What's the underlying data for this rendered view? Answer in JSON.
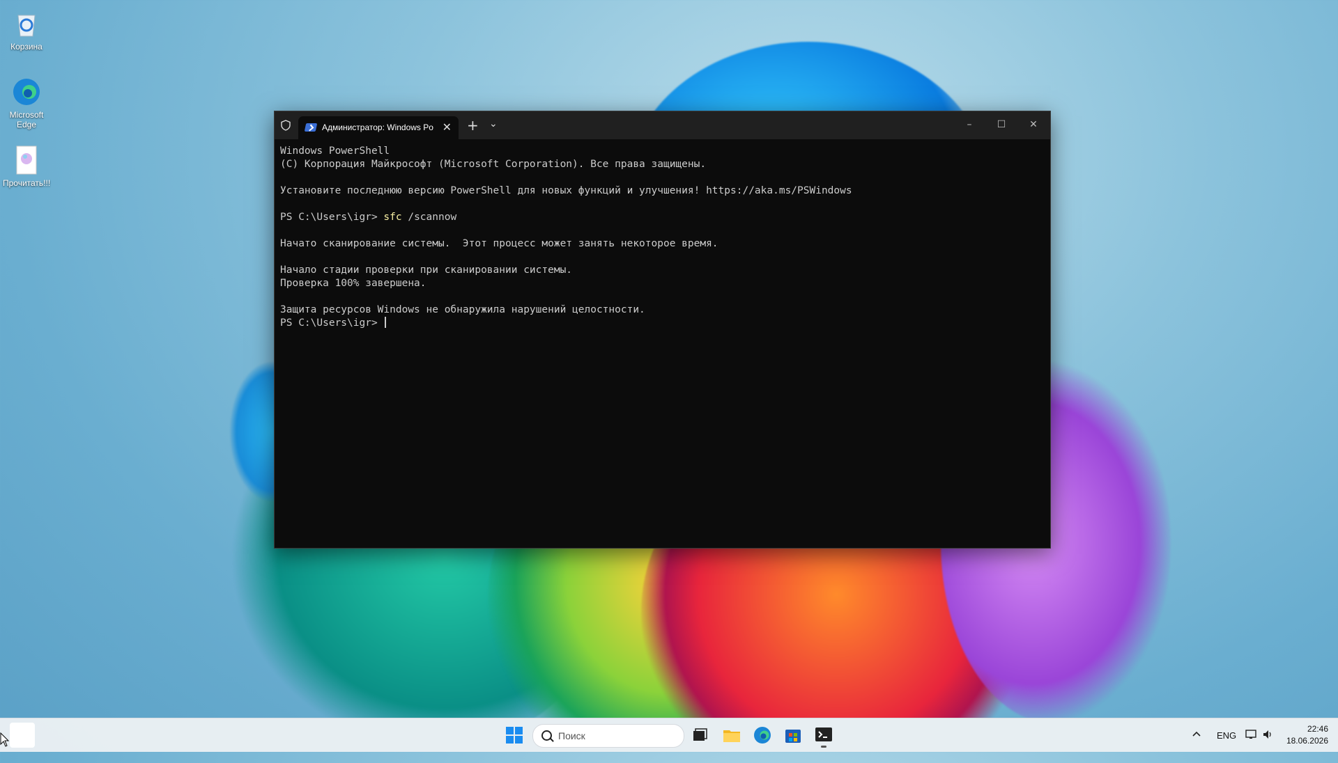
{
  "desktop": {
    "icons": [
      {
        "label": "Корзина",
        "icon": "recycle-bin-icon"
      },
      {
        "label": "Microsoft Edge",
        "icon": "edge-icon"
      },
      {
        "label": "Прочитать!!!",
        "icon": "document-icon"
      }
    ]
  },
  "terminal": {
    "tab_title": "Администратор: Windows Po",
    "controls": {
      "minimize": "–",
      "maximize": "☐",
      "close": "✕",
      "new_tab": "+",
      "dropdown": "⌄",
      "tab_close": "✕"
    },
    "lines": [
      {
        "text": "Windows PowerShell"
      },
      {
        "text": "(C) Корпорация Майкрософт (Microsoft Corporation). Все права защищены."
      },
      {
        "text": ""
      },
      {
        "text": "Установите последнюю версию PowerShell для новых функций и улучшения! https://aka.ms/PSWindows"
      },
      {
        "text": ""
      },
      {
        "prompt": "PS C:\\Users\\igr> ",
        "command": "sfc",
        "args": " /scannow"
      },
      {
        "text": ""
      },
      {
        "text": "Начато сканирование системы.  Этот процесс может занять некоторое время."
      },
      {
        "text": ""
      },
      {
        "text": "Начало стадии проверки при сканировании системы."
      },
      {
        "text": "Проверка 100% завершена."
      },
      {
        "text": ""
      },
      {
        "text": "Защита ресурсов Windows не обнаружила нарушений целостности."
      },
      {
        "prompt": "PS C:\\Users\\igr> ",
        "cursor": true
      }
    ],
    "colors": {
      "background": "#0c0c0c",
      "foreground": "#cccccc",
      "command": "#f9f1a5",
      "titlebar": "#202020"
    }
  },
  "taskbar": {
    "search_placeholder": "Поиск",
    "apps": [
      "start-icon",
      "task-view-icon",
      "file-explorer-icon",
      "edge-icon",
      "store-icon",
      "terminal-icon"
    ],
    "tray": {
      "language": "ENG"
    },
    "clock": {
      "time": "22:46",
      "date": "18.06.2026"
    }
  }
}
